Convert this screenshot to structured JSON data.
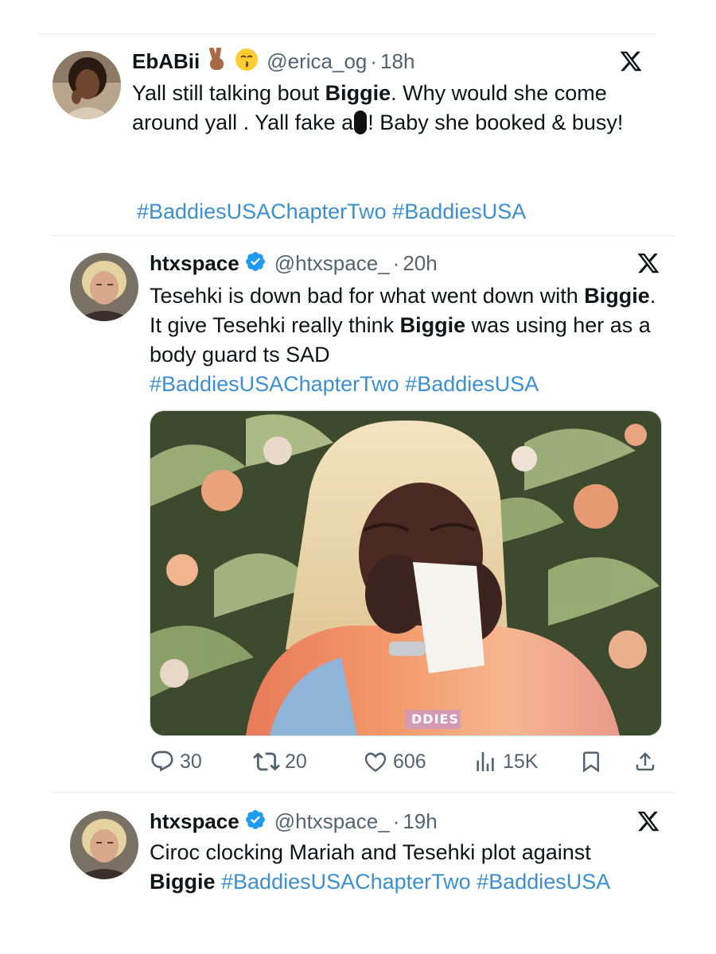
{
  "tweets": [
    {
      "name": "EbABii",
      "handle": "@erica_og",
      "separator": "·",
      "time": "18h",
      "text_1": "Yall still talking bout ",
      "bold_1": "Biggie",
      "text_2": ". Why would she come around yall . Yall fake a",
      "text_3": "! Baby she booked & busy!",
      "hashtags": "#BaddiesUSAChapterTwo #BaddiesUSA",
      "emoji_icons": [
        "victory-hand-icon",
        "kissing-face-icon"
      ]
    },
    {
      "name": "htxspace",
      "handle": "@htxspace_",
      "separator": "·",
      "time": "20h",
      "text_1": "Tesehki is down bad for what went down with ",
      "bold_1": "Biggie",
      "text_2": ". It give Tesehki really think ",
      "bold_2": "Biggie",
      "text_3": " was using her as a body guard ts SAD",
      "hashtags": "#BaddiesUSAChapterTwo #BaddiesUSA",
      "media_caption": "DDIES",
      "stats": {
        "replies": "30",
        "reposts": "20",
        "likes": "606",
        "views": "15K"
      }
    },
    {
      "name": "htxspace",
      "handle": "@htxspace_",
      "separator": "·",
      "time": "19h",
      "text_1": "Ciroc clocking Mariah and Tesehki plot against",
      "bold_1": "Biggie",
      "hashtags": " #BaddiesUSAChapterTwo #BaddiesUSA"
    }
  ],
  "colors": {
    "hashtag": "#1d9bf0",
    "muted": "#536471",
    "verified": "#1d9bf0",
    "divider": "#e6e9ec"
  }
}
